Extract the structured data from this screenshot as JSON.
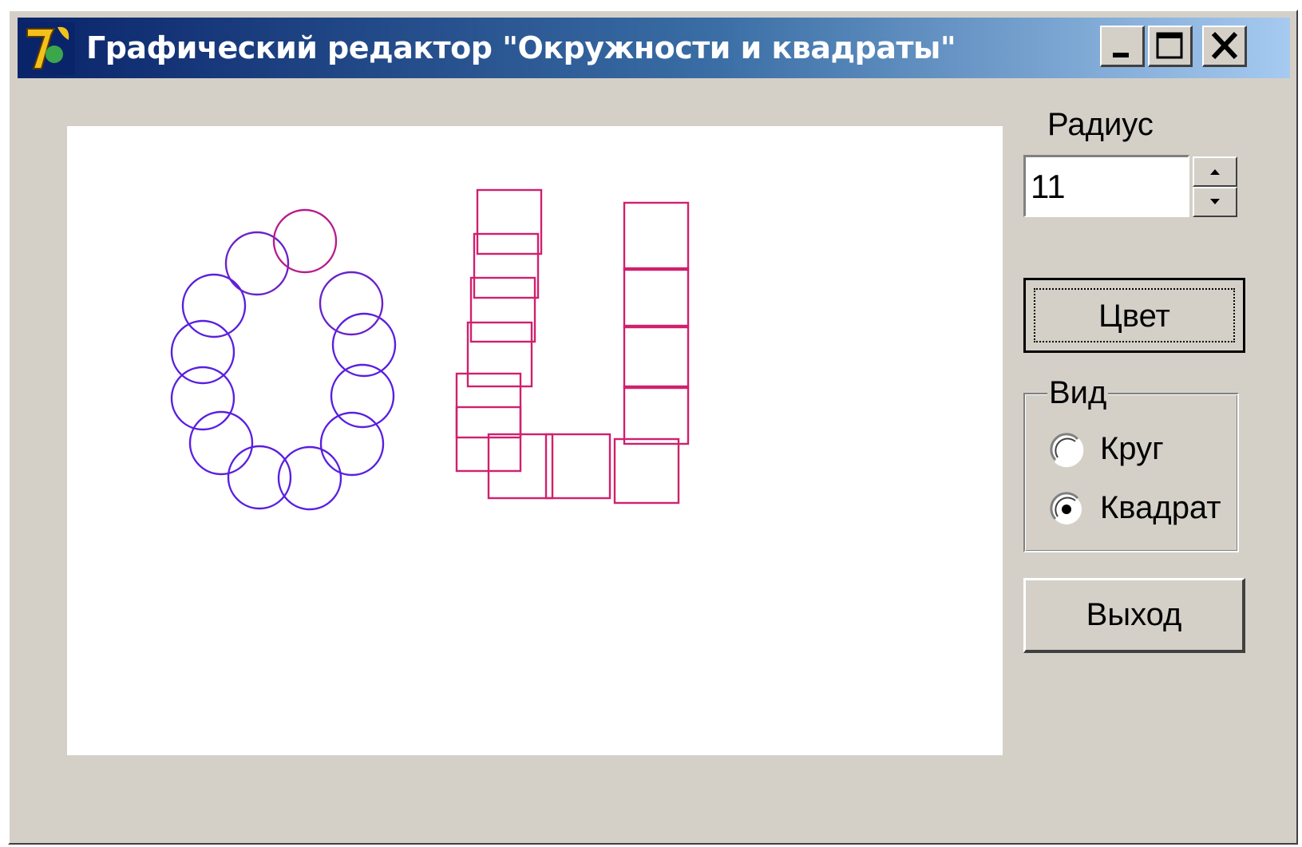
{
  "window": {
    "title": "Графический редактор \"Окружности и квадраты\""
  },
  "controls": {
    "radius_label": "Радиус",
    "radius_value": "11",
    "color_button": "Цвет",
    "view_group_title": "Вид",
    "options": [
      {
        "label": "Круг",
        "checked": false
      },
      {
        "label": "Квадрат",
        "checked": true
      }
    ],
    "exit_button": "Выход"
  },
  "colors": {
    "title_bar_start": "#0a246a",
    "title_bar_end": "#a6caf0",
    "face": "#d4d0c8",
    "circle_stroke": "#5a1fe0",
    "square_stroke": "#d0206e"
  }
}
